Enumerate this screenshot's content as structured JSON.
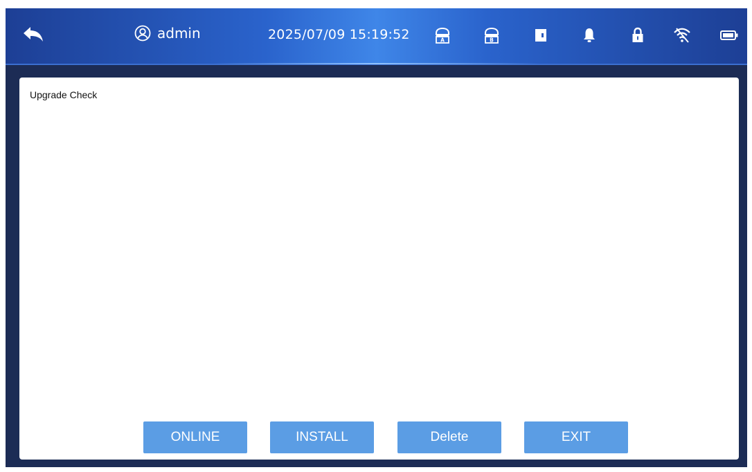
{
  "header": {
    "username": "admin",
    "datetime": "2025/07/09 15:19:52",
    "icons": [
      "back-arrow-icon",
      "user-icon",
      "sd-card-a-icon",
      "sd-card-b-icon",
      "door-icon",
      "alarm-bell-icon",
      "lock-icon",
      "wifi-icon",
      "battery-icon"
    ]
  },
  "panel": {
    "title": "Upgrade Check"
  },
  "buttons": {
    "online": "ONLINE",
    "install": "INSTALL",
    "delete": "Delete",
    "exit": "EXIT"
  },
  "colors": {
    "header_gradient_center": "#3f86e8",
    "header_gradient_edge": "#1d3f95",
    "frame": "#1c2c55",
    "button": "#5b9de4",
    "panel": "#ffffff"
  }
}
